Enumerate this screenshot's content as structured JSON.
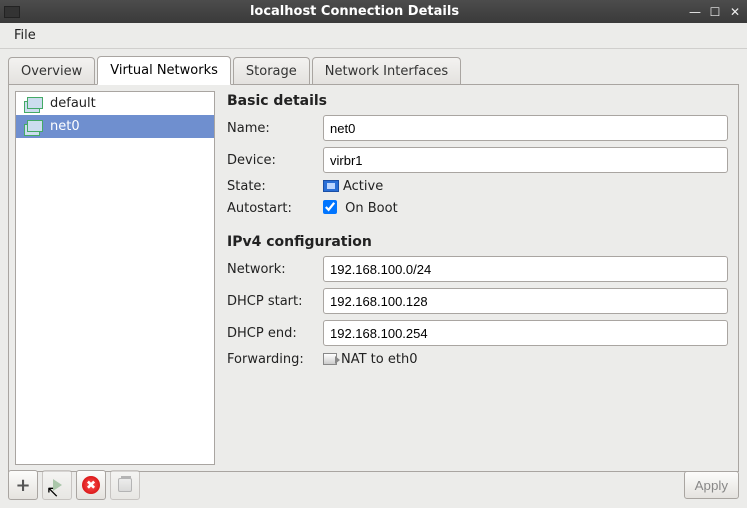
{
  "window": {
    "title": "localhost Connection Details"
  },
  "menu": {
    "file": "File"
  },
  "tabs": {
    "overview": "Overview",
    "virtual_networks": "Virtual Networks",
    "storage": "Storage",
    "network_interfaces": "Network Interfaces"
  },
  "networks": [
    {
      "name": "default"
    },
    {
      "name": "net0"
    }
  ],
  "basic": {
    "heading": "Basic details",
    "name_label": "Name:",
    "name_value": "net0",
    "device_label": "Device:",
    "device_value": "virbr1",
    "state_label": "State:",
    "state_value": "Active",
    "autostart_label": "Autostart:",
    "autostart_text": "On Boot",
    "autostart_checked": true
  },
  "ipv4": {
    "heading": "IPv4 configuration",
    "network_label": "Network:",
    "network_value": "192.168.100.0/24",
    "dhcp_start_label": "DHCP start:",
    "dhcp_start_value": "192.168.100.128",
    "dhcp_end_label": "DHCP end:",
    "dhcp_end_value": "192.168.100.254",
    "forwarding_label": "Forwarding:",
    "forwarding_value": "NAT to eth0"
  },
  "buttons": {
    "apply": "Apply"
  }
}
